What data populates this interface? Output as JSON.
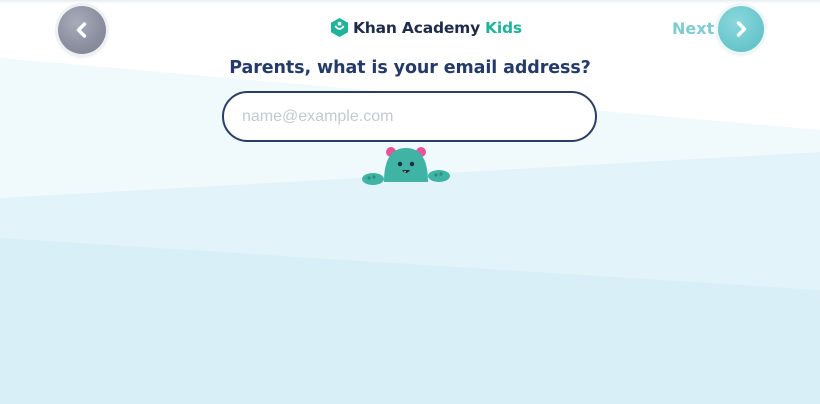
{
  "header": {
    "logo_brand": "Khan Academy",
    "logo_kids": "Kids",
    "next_label": "Next"
  },
  "form": {
    "heading": "Parents, what is your email address?",
    "email_placeholder": "name@example.com",
    "email_value": ""
  },
  "icons": {
    "back": "chevron-left-icon",
    "next": "chevron-right-icon",
    "logo": "khan-academy-hexagon-icon",
    "mascot": "peeking-bear-mascot"
  },
  "colors": {
    "brand_green": "#1fb39a",
    "heading_navy": "#243b6a",
    "back_button_gray": "#8c90a0",
    "next_button_teal": "#6ec9cf",
    "background_light_blue": "#dcf1f8"
  }
}
